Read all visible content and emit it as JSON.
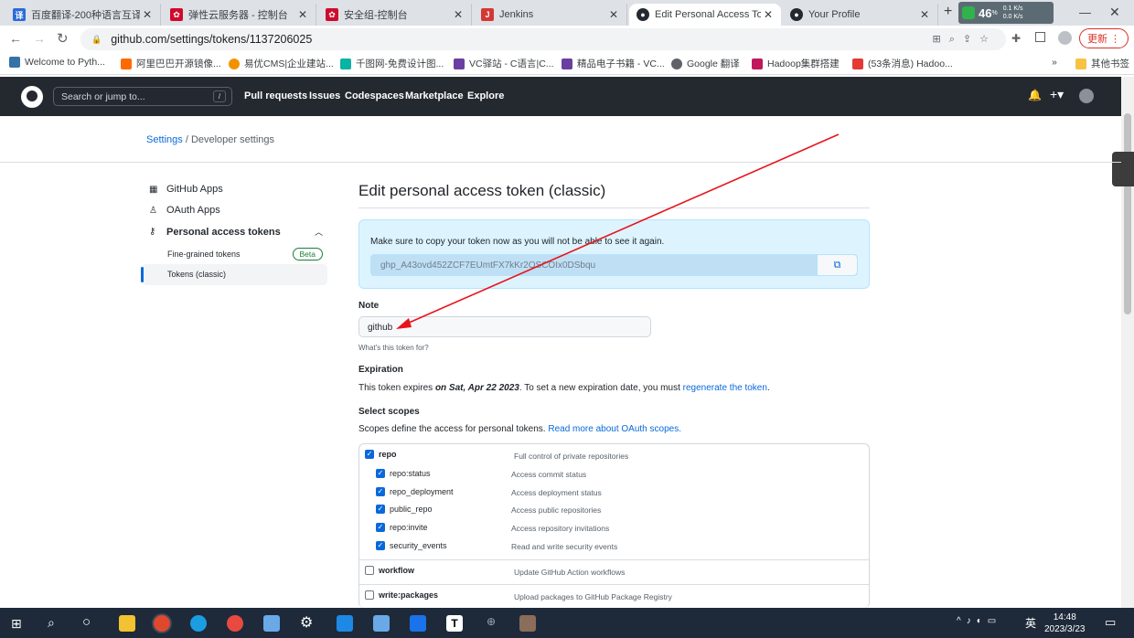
{
  "tabs": [
    {
      "title": "百度翻译-200种语言互译、",
      "icon": "baidu-translate-icon",
      "color": "#2c6bd6"
    },
    {
      "title": "弹性云服务器 - 控制台",
      "icon": "huawei-icon",
      "color": "#cf0a2c"
    },
    {
      "title": "安全组-控制台",
      "icon": "huawei-icon",
      "color": "#cf0a2c"
    },
    {
      "title": "Jenkins",
      "icon": "jenkins-icon",
      "color": "#d33833"
    },
    {
      "title": "Edit Personal Access Tok",
      "icon": "github-icon",
      "color": "#24292f"
    },
    {
      "title": "Your Profile",
      "icon": "github-icon",
      "color": "#24292f"
    }
  ],
  "browser": {
    "url": "github.com/settings/tokens/1137206025",
    "update_label": "更新",
    "net_badge": "46",
    "net_unit": "%",
    "net_up": "0.1 K/s",
    "net_down": "0.0 K/s"
  },
  "bookmarks": [
    "Welcome to Pyth...",
    "阿里巴巴开源镜像...",
    "易优CMS|企业建站...",
    "千图网-免费设计图...",
    "VC驿站 - C语言|C...",
    "精品电子书籍 - VC...",
    "Google 翻译",
    "Hadoop集群搭建",
    "(53条消息) Hadoo..."
  ],
  "bookmarks_other": "其他书签",
  "github": {
    "search_placeholder": "Search or jump to...",
    "search_key": "/",
    "nav": [
      "Pull requests",
      "Issues",
      "Codespaces",
      "Marketplace",
      "Explore"
    ]
  },
  "breadcrumb": {
    "settings": "Settings",
    "sep": "/",
    "current": "Developer settings"
  },
  "sidebar": {
    "github_apps": "GitHub Apps",
    "oauth_apps": "OAuth Apps",
    "pat": "Personal access tokens",
    "fine_grained": "Fine-grained tokens",
    "beta": "Beta",
    "classic": "Tokens (classic)"
  },
  "main": {
    "title": "Edit personal access token (classic)",
    "flash_text": "Make sure to copy your token now as you will not be able to see it again.",
    "token": "ghp_A43ovd452ZCF7EUmtFX7kKr2OSCOIx0DSbqu",
    "note_label": "Note",
    "note_value": "github",
    "note_hint": "What's this token for?",
    "expiration_label": "Expiration",
    "exp_pre": "This token expires ",
    "exp_date": "on Sat, Apr 22 2023",
    "exp_mid": ". To set a new expiration date, you must ",
    "exp_link": "regenerate the token",
    "exp_end": ".",
    "scopes_label": "Select scopes",
    "scopes_pre": "Scopes define the access for personal tokens. ",
    "scopes_link": "Read more about OAuth scopes."
  },
  "scopes": [
    {
      "name": "repo",
      "desc": "Full control of private repositories",
      "checked": true,
      "sub": false
    },
    {
      "name": "repo:status",
      "desc": "Access commit status",
      "checked": true,
      "sub": true
    },
    {
      "name": "repo_deployment",
      "desc": "Access deployment status",
      "checked": true,
      "sub": true
    },
    {
      "name": "public_repo",
      "desc": "Access public repositories",
      "checked": true,
      "sub": true
    },
    {
      "name": "repo:invite",
      "desc": "Access repository invitations",
      "checked": true,
      "sub": true
    },
    {
      "name": "security_events",
      "desc": "Read and write security events",
      "checked": true,
      "sub": true
    },
    {
      "name": "workflow",
      "desc": "Update GitHub Action workflows",
      "checked": false,
      "sub": false
    },
    {
      "name": "write:packages",
      "desc": "Upload packages to GitHub Package Registry",
      "checked": false,
      "sub": false
    }
  ],
  "taskbar": {
    "time": "14:48",
    "date": "2023/3/23",
    "ime": "英"
  }
}
